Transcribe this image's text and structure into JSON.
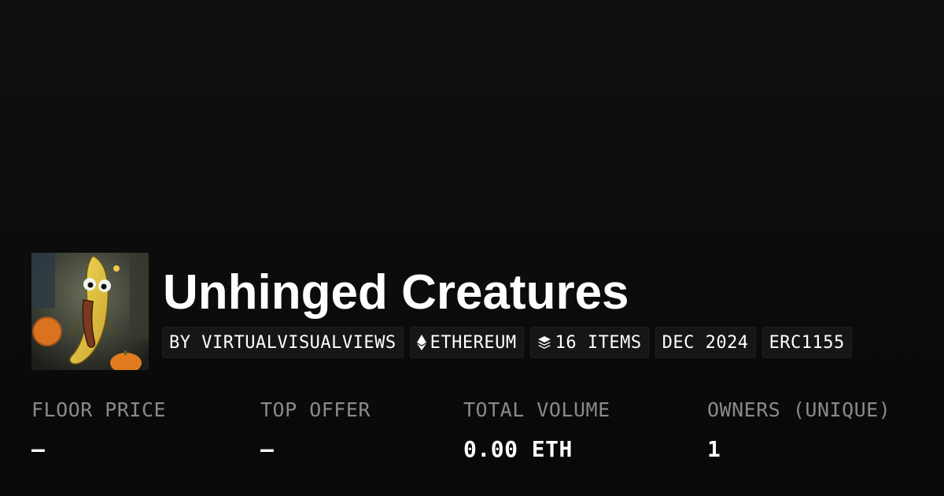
{
  "collection": {
    "title": "Unhinged Creatures",
    "image_subject": "banana-creature-artwork"
  },
  "tags": [
    {
      "label": "BY VIRTUALVISUALVIEWS",
      "icon": null
    },
    {
      "label": "ETHEREUM",
      "icon": "ethereum-icon"
    },
    {
      "label": "16 ITEMS",
      "icon": "layers-icon"
    },
    {
      "label": "DEC 2024",
      "icon": null
    },
    {
      "label": "ERC1155",
      "icon": null
    }
  ],
  "stats": [
    {
      "label": "FLOOR PRICE",
      "value": "–"
    },
    {
      "label": "TOP OFFER",
      "value": "–"
    },
    {
      "label": "TOTAL VOLUME",
      "value": "0.00 ETH"
    },
    {
      "label": "OWNERS (UNIQUE)",
      "value": "1"
    }
  ],
  "colors": {
    "background": "#0c0c0c",
    "tag_background": "#161616",
    "label_gray": "#8a8a8a",
    "text": "#ffffff"
  }
}
